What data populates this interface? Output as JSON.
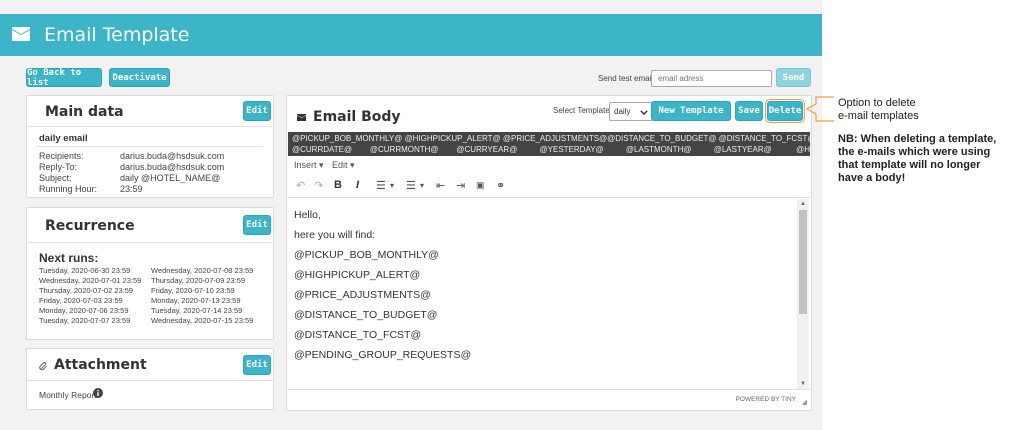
{
  "header": {
    "title": "Email Template",
    "icon": "envelope-icon"
  },
  "topbar": {
    "go_back_label": "Go Back to list",
    "deactivate_label": "Deactivate",
    "send_test_label": "Send test email:",
    "email_placeholder": "email adress",
    "send_label": "Send"
  },
  "main_data": {
    "title": "Main data",
    "edit_label": "Edit",
    "name": "daily email",
    "fields": [
      {
        "label": "Recipients:",
        "value": "darius.buda@hsdsuk.com"
      },
      {
        "label": "Reply-To:",
        "value": "darius.buda@hsdsuk.com"
      },
      {
        "label": "Subject:",
        "value": "daily @HOTEL_NAME@"
      },
      {
        "label": "Running Hour:",
        "value": "23:59"
      }
    ]
  },
  "recurrence": {
    "title": "Recurrence",
    "edit_label": "Edit",
    "next_runs_label": "Next runs:",
    "col1": [
      "Tuesday, 2020-06-30 23:59",
      "Wednesday, 2020-07-01 23:59",
      "Thursday, 2020-07-02 23:59",
      "Friday, 2020-07-03 23:59",
      "Monday, 2020-07-06 23:59",
      "Tuesday, 2020-07-07 23:59"
    ],
    "col2": [
      "Wednesday, 2020-07-08 23:59",
      "Thursday, 2020-07-09 23:59",
      "Friday, 2020-07-10 23:59",
      "Monday, 2020-07-13 23:59",
      "Tuesday, 2020-07-14 23:59",
      "Wednesday, 2020-07-15 23:59"
    ]
  },
  "attachment": {
    "title": "Attachment",
    "edit_label": "Edit",
    "item": "Monthly Report"
  },
  "email_body": {
    "title": "Email Body",
    "select_template_label": "Select Template:",
    "selected_template": "daily",
    "new_template_label": "New Template",
    "save_label": "Save",
    "delete_label": "Delete",
    "variables_line1": "@PICKUP_BOB_MONTHLY@ @HIGHPICKUP_ALERT@ @PRICE_ADJUSTMENTS@@DISTANCE_TO_BUDGET@ @DISTANCE_TO_FCST@ @PENDING_GROUP_REQUESTS@",
    "variables_line2": "@CURRDATE@        @CURRMONTH@        @CURRYEAR@          @YESTERDAY@          @LASTMONTH@          @LASTYEAR@           @HOTEL_NAME@",
    "menu_insert": "Insert",
    "menu_edit": "Edit",
    "content": [
      "Hello,",
      "here you will find:",
      "@PICKUP_BOB_MONTHLY@",
      "@HIGHPICKUP_ALERT@",
      "@PRICE_ADJUSTMENTS@",
      "@DISTANCE_TO_BUDGET@",
      "@DISTANCE_TO_FCST@",
      "@PENDING_GROUP_REQUESTS@"
    ],
    "powered_by": "POWERED BY TINY"
  },
  "annotation": {
    "line1": "Option to delete",
    "line2": "e-mail templates",
    "note1": "NB: When deleting a template,",
    "note2": "the e-mails which were using",
    "note3": "that template will no longer",
    "note4": "have a body!"
  },
  "colors": {
    "accent": "#3db5c9",
    "callout": "#f0a040"
  }
}
